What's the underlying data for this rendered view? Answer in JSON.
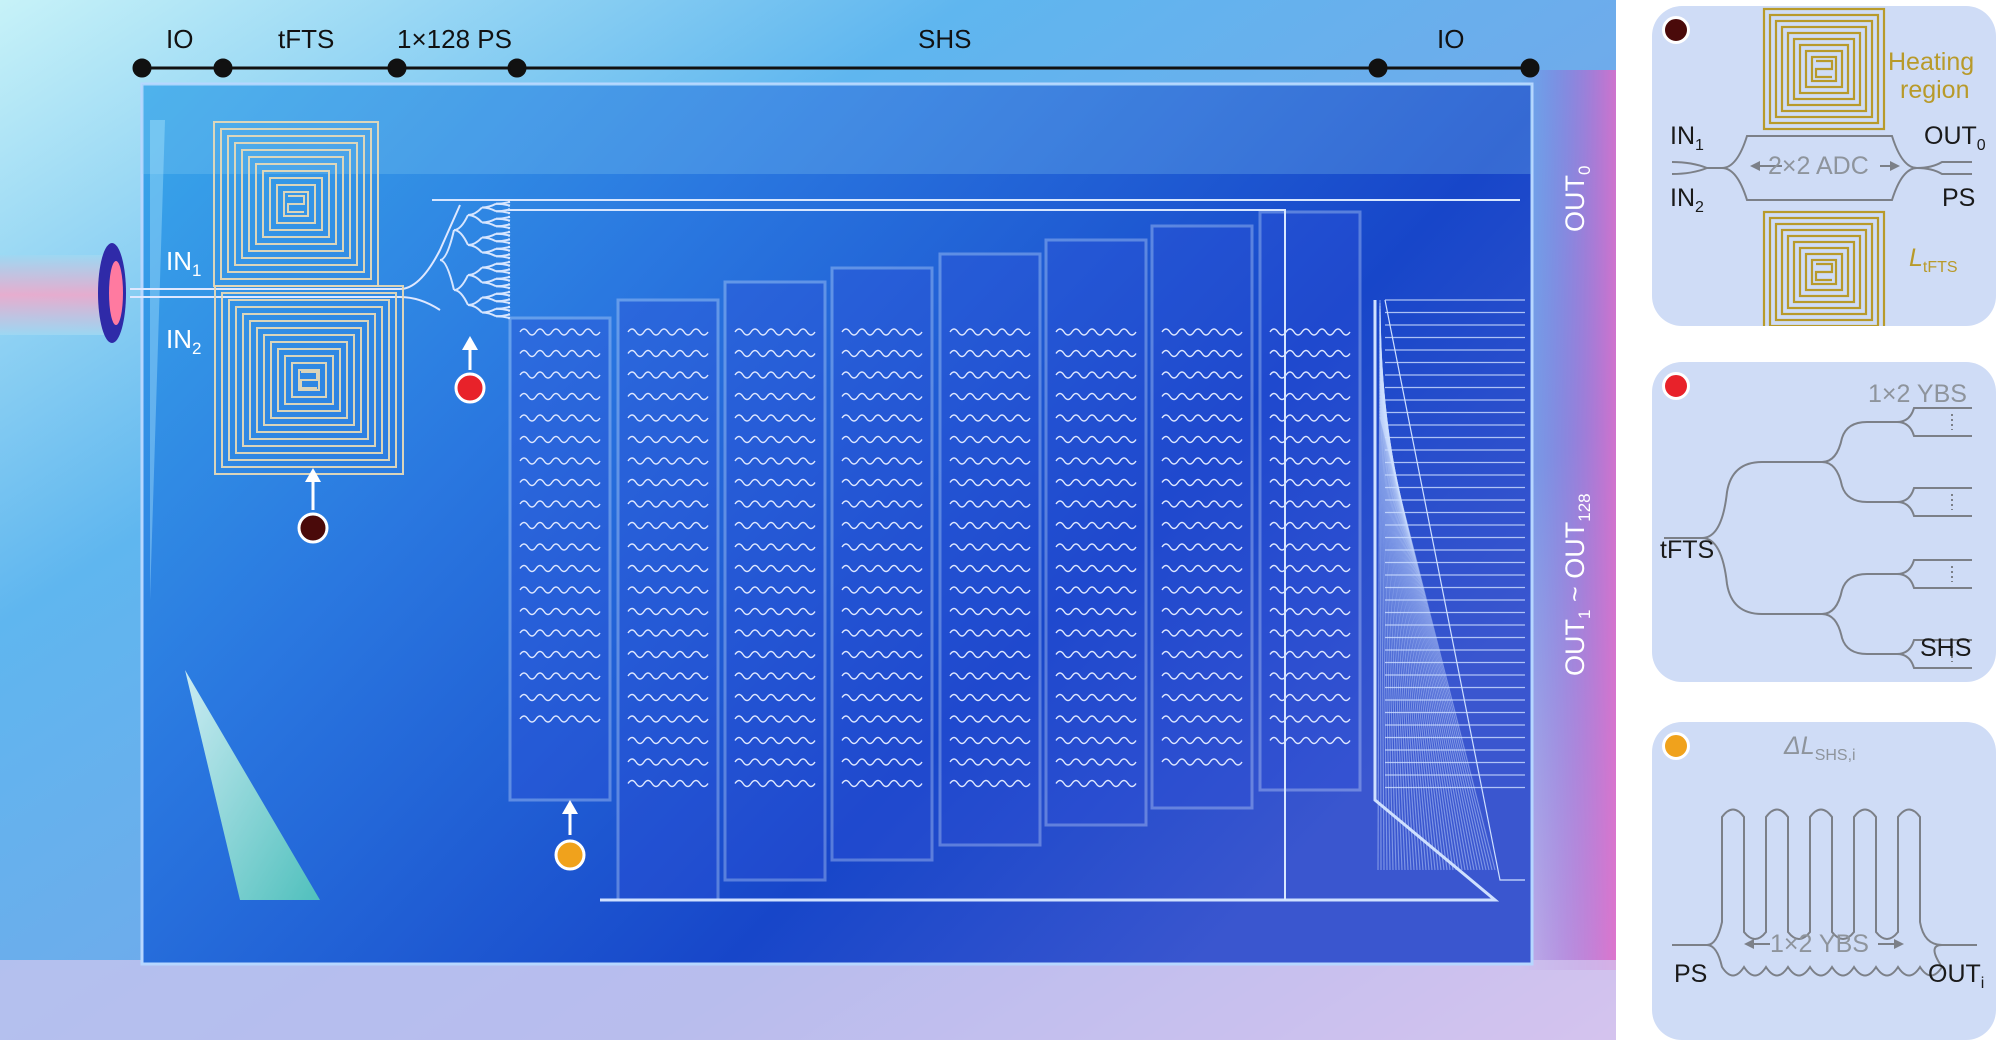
{
  "top_bar": {
    "segments": [
      "IO",
      "tFTS",
      "1×128 PS",
      "SHS",
      "IO"
    ]
  },
  "chip": {
    "in1": {
      "main": "IN",
      "sub": "1"
    },
    "in2": {
      "main": "IN",
      "sub": "2"
    },
    "out0": {
      "main": "OUT",
      "sub": "0"
    },
    "out_range": {
      "a": "OUT",
      "a_sub": "1",
      "mid": " ~ ",
      "b": "OUT",
      "b_sub": "128"
    }
  },
  "markers": {
    "adc_color": "#4a0a0a",
    "ybs_color": "#e8222a",
    "shs_color": "#f0a21c"
  },
  "panel_adc": {
    "heating_line1": "Heating",
    "heating_line2": "region",
    "in1": {
      "main": "IN",
      "sub": "1"
    },
    "in2": {
      "main": "IN",
      "sub": "2"
    },
    "out0": {
      "main": "OUT",
      "sub": "0"
    },
    "ps": "PS",
    "adc": "2×2 ADC",
    "ltfts": {
      "main": "L",
      "sub": "tFTS"
    }
  },
  "panel_ybs": {
    "title": "1×2 YBS",
    "left": "tFTS",
    "right": "SHS"
  },
  "panel_shs": {
    "delta": {
      "main": "ΔL",
      "sub": "SHS,i"
    },
    "ybs": "1×2 YBS",
    "left": "PS",
    "right": {
      "main": "OUT",
      "sub": "i"
    }
  },
  "colors": {
    "gold": "#b89a2a",
    "panel_bg": "#cfdcf6",
    "waveguide_grey": "#7c8088"
  }
}
